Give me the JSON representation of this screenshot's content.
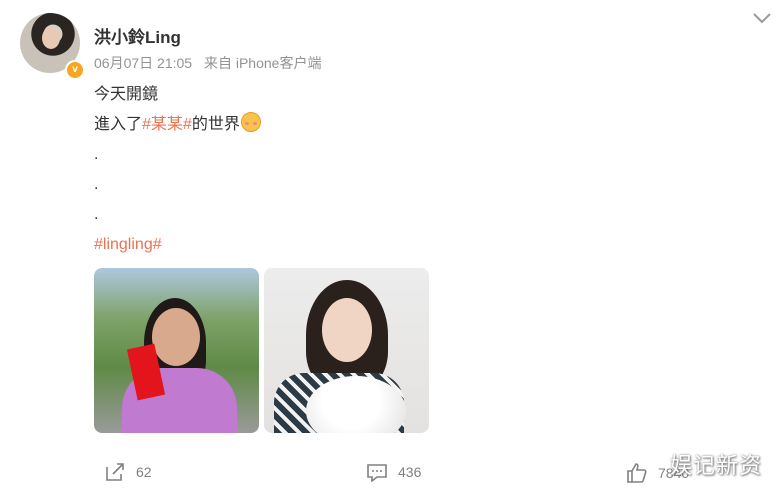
{
  "post": {
    "username": "洪小鈴Ling",
    "date": "06月07日 21:05",
    "source": "来自 iPhone客户端",
    "verified_badge": "v",
    "content": {
      "line1": "今天開鏡",
      "line2_prefix": "進入了",
      "line2_tag": "#某某#",
      "line2_suffix": "的世界",
      "dot1": ".",
      "dot2": ".",
      "dot3": ".",
      "tag_line": "#lingling#"
    },
    "icons": {
      "emoji": "smiling-face-with-hearts-icon",
      "options": "chevron-down-icon"
    }
  },
  "actions": {
    "share_count": "62",
    "comment_count": "436",
    "like_count": "7840"
  },
  "watermark": "娱记新资",
  "colors": {
    "tag": "#eb7350",
    "meta": "#939393",
    "badge": "#f6a623"
  }
}
